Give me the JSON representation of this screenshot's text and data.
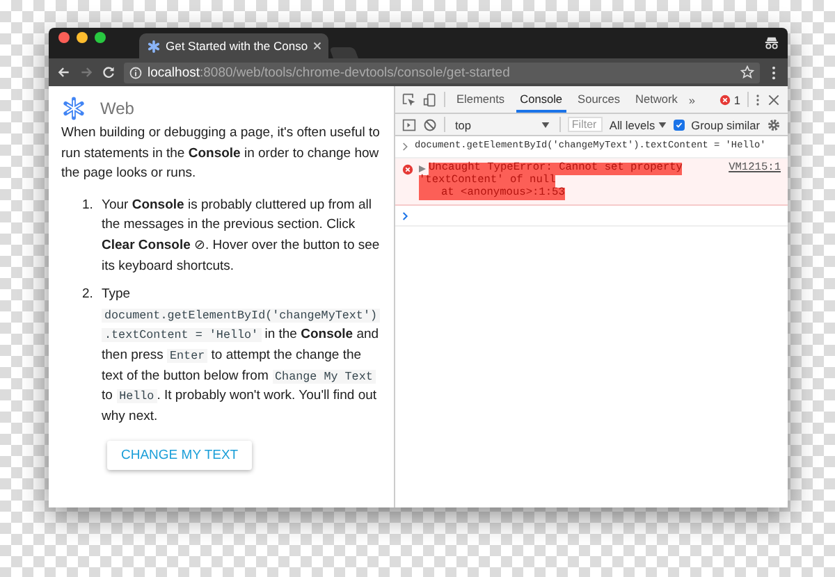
{
  "window": {
    "tab_title": "Get Started with the Conso",
    "url_host": "localhost",
    "url_path": ":8080/web/tools/chrome-devtools/console/get-started"
  },
  "page": {
    "section": "Web",
    "intro": "When building or debugging a page, it's often useful to run statements in the **Console** in order to change how the page looks or runs.",
    "steps": [
      {
        "number": "1.",
        "segments": [
          {
            "kind": "text",
            "text": "Your **Console** is probably cluttered up from all the messages in the previous section. Click **Clear Console** ⊘. Hover over the button to see its keyboard shortcuts."
          }
        ]
      },
      {
        "number": "2.",
        "segments": [
          {
            "kind": "text",
            "text": "Type "
          },
          {
            "kind": "code",
            "text": "document.getElementById('changeMyText')"
          },
          {
            "kind": "code",
            "text": ".textContent = 'Hello'"
          },
          {
            "kind": "text",
            "text": " in the **Console** and then press "
          },
          {
            "kind": "code",
            "text": "Enter"
          },
          {
            "kind": "text",
            "text": " to attempt the change the text of the button below from "
          },
          {
            "kind": "code",
            "text": "Change My Text"
          },
          {
            "kind": "text",
            "text": " to "
          },
          {
            "kind": "code",
            "text": "Hello"
          },
          {
            "kind": "text",
            "text": ". It probably won't work. You'll find out why next."
          }
        ]
      }
    ],
    "button": "CHANGE MY TEXT"
  },
  "devtools": {
    "tabs": [
      {
        "label": "Elements",
        "selected": false
      },
      {
        "label": "Console",
        "selected": true
      },
      {
        "label": "Sources",
        "selected": false
      },
      {
        "label": "Network",
        "selected": false
      }
    ],
    "more": "»",
    "error_count": "1",
    "context": "top",
    "filter_placeholder": "Filter",
    "levels": "All levels",
    "group_similar": {
      "label": "Group similar",
      "checked": true
    },
    "messages": [
      {
        "kind": "input",
        "text": "document.getElementById('changeMyText').textContent = 'Hello'"
      },
      {
        "kind": "error",
        "lines": [
          "Uncaught TypeError: Cannot set property",
          "'textContent' of null",
          "at <anonymous>:1:53"
        ],
        "source": "VM1215:1"
      }
    ]
  }
}
